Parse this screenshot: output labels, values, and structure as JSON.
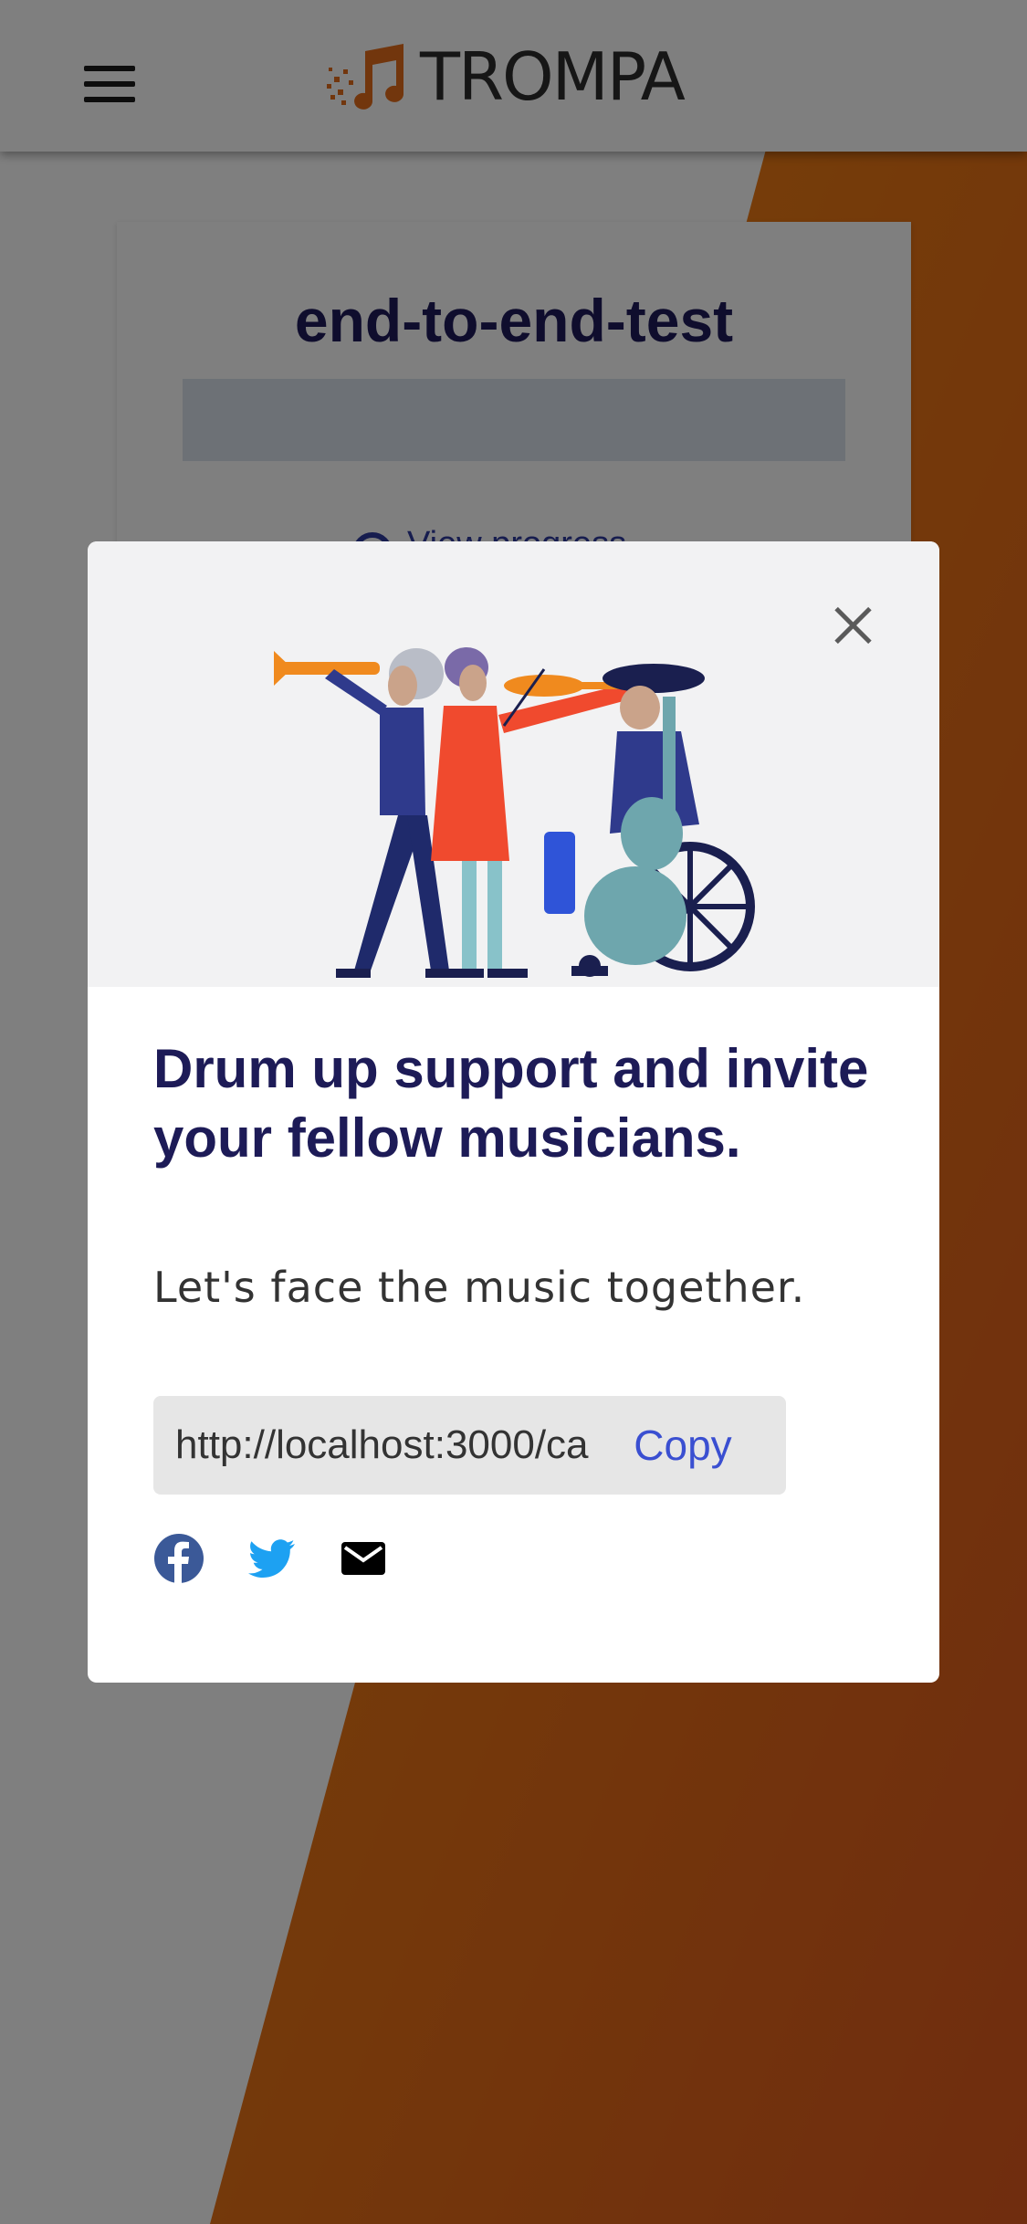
{
  "header": {
    "brand": "TROMPA",
    "logo_icon": "music-note-icon",
    "menu_icon": "hamburger-menu-icon"
  },
  "campaign_card": {
    "title": "end-to-end-test",
    "link_label": "View progress"
  },
  "modal": {
    "close_icon": "close-icon",
    "heading": "Drum up support and invite your fellow musicians.",
    "subtitle": "Let's face the music together.",
    "share_url": "http://localhost:3000/ca",
    "copy_label": "Copy",
    "social": [
      {
        "name": "facebook-icon",
        "color": "#3b5998"
      },
      {
        "name": "twitter-icon",
        "color": "#1da1f2"
      },
      {
        "name": "mail-icon",
        "color": "#000000"
      }
    ]
  },
  "colors": {
    "accent_orange": "#e46c1a",
    "brand_navy": "#1d1b57",
    "link_blue": "#3a4fd1"
  }
}
